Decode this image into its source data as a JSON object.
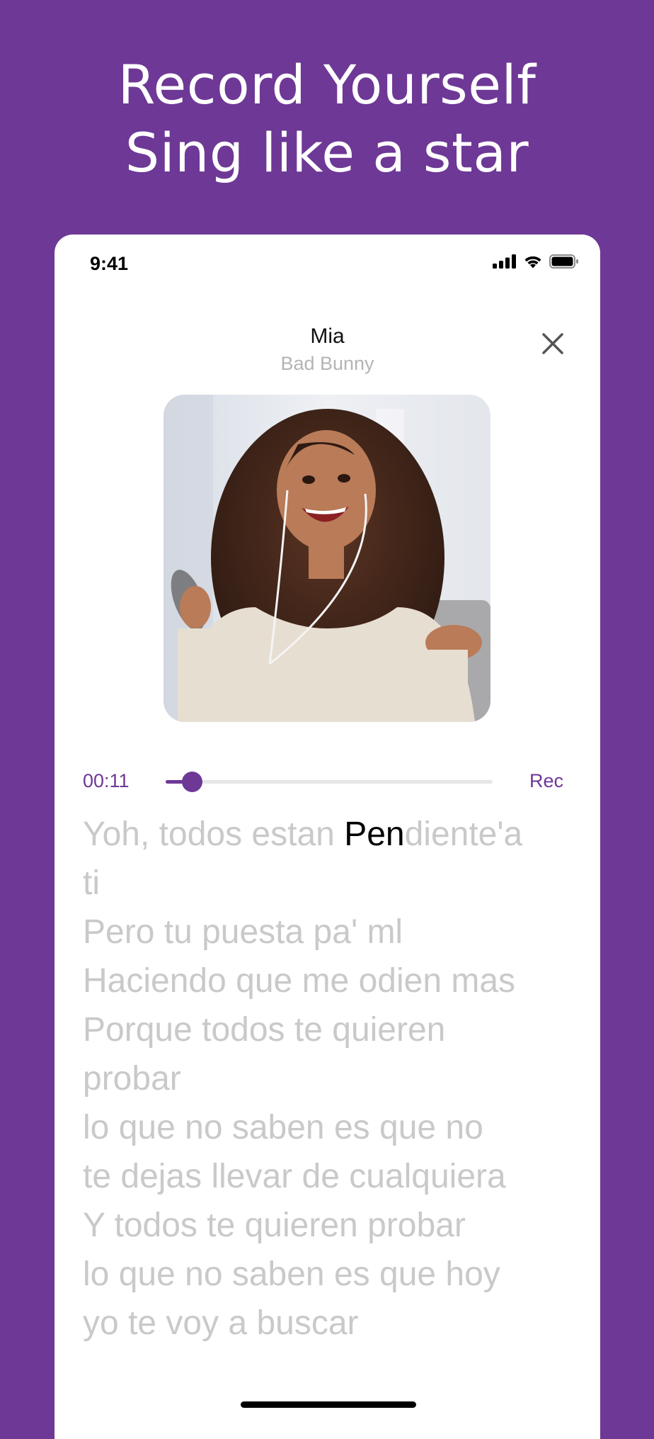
{
  "promo": {
    "line1": "Record Yourself",
    "line2": "Sing like a star"
  },
  "status_bar": {
    "time": "9:41",
    "icons": [
      "signal-icon",
      "wifi-icon",
      "battery-icon"
    ]
  },
  "song": {
    "title": "Mia",
    "artist": "Bad Bunny"
  },
  "player": {
    "elapsed": "00:11",
    "progress_fraction": 0.08,
    "rec_label": "Rec"
  },
  "lyrics": {
    "current_line": {
      "before": "Yoh, todos estan ",
      "highlight": "Pen",
      "after": "diente'a"
    },
    "lines": [
      "ti",
      "Pero tu puesta pa' ml",
      "Haciendo que me odien mas",
      "Porque todos te quieren",
      "probar",
      "lo que no saben es que no",
      "te dejas llevar de cualquiera",
      "Y todos te quieren probar",
      "lo que no saben es que hoy",
      "yo te voy a buscar"
    ]
  },
  "colors": {
    "brand_purple": "#6e3896",
    "lyric_inactive": "#c9c9c9",
    "lyric_active": "#000000",
    "artist_gray": "#b4b4b4"
  }
}
